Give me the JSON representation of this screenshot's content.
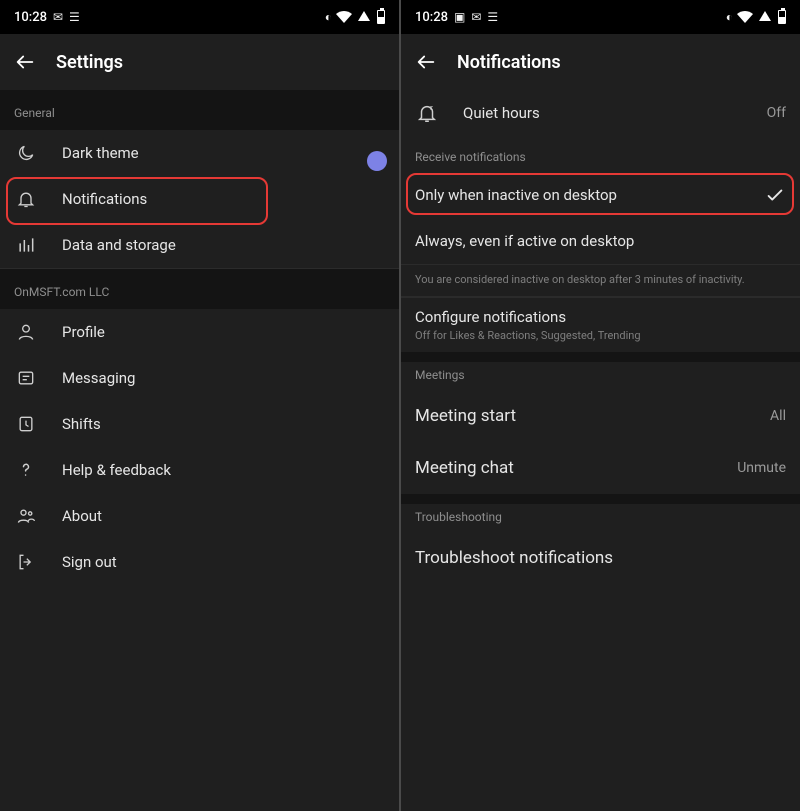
{
  "status": {
    "time": "10:28"
  },
  "left": {
    "title": "Settings",
    "section_general": "General",
    "dark_theme": "Dark theme",
    "notifications": "Notifications",
    "data_storage": "Data and storage",
    "section_org": "OnMSFT.com LLC",
    "profile": "Profile",
    "messaging": "Messaging",
    "shifts": "Shifts",
    "help": "Help & feedback",
    "about": "About",
    "sign_out": "Sign out"
  },
  "right": {
    "title": "Notifications",
    "quiet_hours": "Quiet hours",
    "quiet_hours_value": "Off",
    "section_receive": "Receive notifications",
    "option_inactive": "Only when inactive on desktop",
    "option_always": "Always, even if active on desktop",
    "inactive_info": "You are considered inactive on desktop after 3 minutes of inactivity.",
    "configure_title": "Configure notifications",
    "configure_sub": "Off for Likes & Reactions, Suggested, Trending",
    "section_meetings": "Meetings",
    "meeting_start": "Meeting start",
    "meeting_start_value": "All",
    "meeting_chat": "Meeting chat",
    "meeting_chat_value": "Unmute",
    "section_trouble": "Troubleshooting",
    "troubleshoot": "Troubleshoot notifications"
  }
}
